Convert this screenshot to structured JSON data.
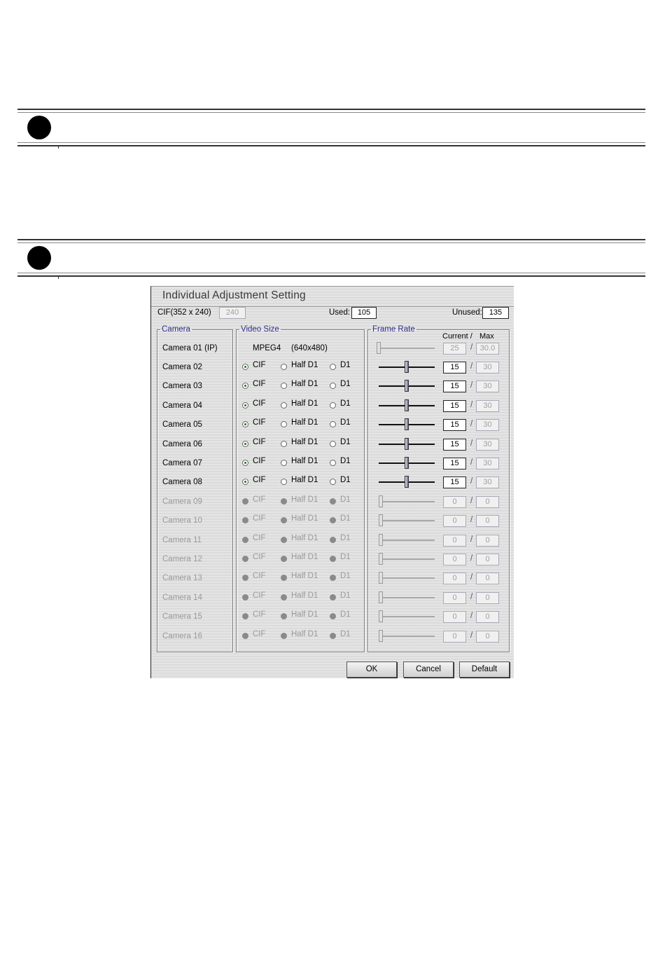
{
  "dialog": {
    "title": "Individual Adjustment Setting",
    "cif_label": "CIF(352 x 240)",
    "cif_value": "240",
    "used_label": "Used:",
    "used_value": "105",
    "unused_label": "Unused:",
    "unused_value": "135",
    "camera_legend": "Camera",
    "video_legend": "Video Size",
    "frame_legend": "Frame Rate",
    "current_header": "Current /",
    "max_header": "Max",
    "camera01": {
      "label": "Camera 01 (IP)",
      "codec": "MPEG4",
      "resolution": "(640x480)",
      "slider_fraction": 0,
      "current": "25",
      "max": "30.0"
    },
    "option_labels": [
      "CIF",
      "Half D1",
      "D1"
    ],
    "cameras": [
      {
        "label": "Camera 02",
        "enabled": true,
        "selected": "CIF",
        "slider_fraction": 0.5,
        "current": "15",
        "max": "30"
      },
      {
        "label": "Camera 03",
        "enabled": true,
        "selected": "CIF",
        "slider_fraction": 0.5,
        "current": "15",
        "max": "30"
      },
      {
        "label": "Camera 04",
        "enabled": true,
        "selected": "CIF",
        "slider_fraction": 0.5,
        "current": "15",
        "max": "30"
      },
      {
        "label": "Camera 05",
        "enabled": true,
        "selected": "CIF",
        "slider_fraction": 0.5,
        "current": "15",
        "max": "30"
      },
      {
        "label": "Camera 06",
        "enabled": true,
        "selected": "CIF",
        "slider_fraction": 0.5,
        "current": "15",
        "max": "30"
      },
      {
        "label": "Camera 07",
        "enabled": true,
        "selected": "CIF",
        "slider_fraction": 0.5,
        "current": "15",
        "max": "30"
      },
      {
        "label": "Camera 08",
        "enabled": true,
        "selected": "CIF",
        "slider_fraction": 0.5,
        "current": "15",
        "max": "30"
      },
      {
        "label": "Camera 09",
        "enabled": false,
        "selected": "",
        "slider_fraction": 0,
        "current": "0",
        "max": "0"
      },
      {
        "label": "Camera 10",
        "enabled": false,
        "selected": "",
        "slider_fraction": 0,
        "current": "0",
        "max": "0"
      },
      {
        "label": "Camera 11",
        "enabled": false,
        "selected": "",
        "slider_fraction": 0,
        "current": "0",
        "max": "0"
      },
      {
        "label": "Camera 12",
        "enabled": false,
        "selected": "",
        "slider_fraction": 0,
        "current": "0",
        "max": "0"
      },
      {
        "label": "Camera 13",
        "enabled": false,
        "selected": "",
        "slider_fraction": 0,
        "current": "0",
        "max": "0"
      },
      {
        "label": "Camera 14",
        "enabled": false,
        "selected": "",
        "slider_fraction": 0,
        "current": "0",
        "max": "0"
      },
      {
        "label": "Camera 15",
        "enabled": false,
        "selected": "",
        "slider_fraction": 0,
        "current": "0",
        "max": "0"
      },
      {
        "label": "Camera 16",
        "enabled": false,
        "selected": "",
        "slider_fraction": 0,
        "current": "0",
        "max": "0"
      }
    ],
    "buttons": {
      "ok": "OK",
      "cancel": "Cancel",
      "default": "Default"
    }
  }
}
